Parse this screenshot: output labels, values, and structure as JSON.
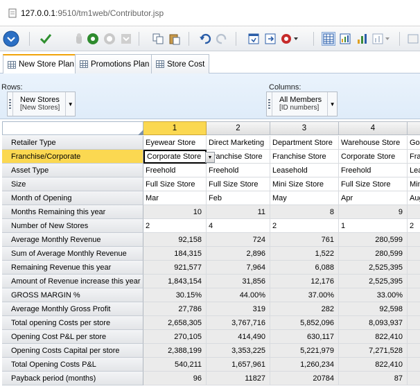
{
  "browser": {
    "url_host": "127.0.0.1",
    "url_path": ":9510/tm1web/Contributor.jsp"
  },
  "tabs": [
    {
      "label": "New Store Plan",
      "active": true
    },
    {
      "label": "Promotions Plan",
      "active": false
    },
    {
      "label": "Store Cost",
      "active": false
    }
  ],
  "dimbar": {
    "rows_label": "Rows:",
    "rows_value": "New Stores",
    "rows_sub": "[New Stores]",
    "columns_label": "Columns:",
    "columns_value": "All Members",
    "columns_sub": "[ID numbers]"
  },
  "grid": {
    "columns": [
      "1",
      "2",
      "3",
      "4",
      ""
    ],
    "selected_column": 0,
    "rows": [
      {
        "label": "Retailer Type",
        "type": "txt",
        "shade": false,
        "values": [
          "Eyewear Store",
          "Direct Marketing",
          "Department Store",
          "Warehouse Store",
          "Gol"
        ]
      },
      {
        "label": "Franchise/Corporate",
        "type": "txt",
        "shade": false,
        "selected": true,
        "values": [
          "Corporate Store",
          "Franchise Store",
          "Franchise Store",
          "Corporate Store",
          "Fra"
        ]
      },
      {
        "label": "Asset Type",
        "type": "txt",
        "shade": false,
        "values": [
          "Freehold",
          "Freehold",
          "Leasehold",
          "Freehold",
          "Lea"
        ]
      },
      {
        "label": "Size",
        "type": "txt",
        "shade": false,
        "values": [
          "Full Size Store",
          "Full Size Store",
          "Mini Size Store",
          "Full Size Store",
          "Min"
        ]
      },
      {
        "label": "Month of Opening",
        "type": "txt",
        "shade": false,
        "values": [
          "Mar",
          "Feb",
          "May",
          "Apr",
          "Aug"
        ]
      },
      {
        "label": "Months Remaining this year",
        "type": "num",
        "shade": true,
        "values": [
          "10",
          "11",
          "8",
          "9",
          ""
        ]
      },
      {
        "label": "Number of New Stores",
        "type": "txt",
        "shade": false,
        "values": [
          "2",
          "4",
          "2",
          "1",
          "2"
        ]
      },
      {
        "label": "Average Monthly Revenue",
        "type": "num",
        "shade": true,
        "values": [
          "92,158",
          "724",
          "761",
          "280,599",
          ""
        ]
      },
      {
        "label": "Sum of Average Monthly Revenue",
        "type": "num",
        "shade": true,
        "values": [
          "184,315",
          "2,896",
          "1,522",
          "280,599",
          ""
        ]
      },
      {
        "label": "Remaining Revenue this year",
        "type": "num",
        "shade": true,
        "values": [
          "921,577",
          "7,964",
          "6,088",
          "2,525,395",
          ""
        ]
      },
      {
        "label": "Amount of Revenue increase this year",
        "type": "num",
        "shade": true,
        "values": [
          "1,843,154",
          "31,856",
          "12,176",
          "2,525,395",
          ""
        ]
      },
      {
        "label": "GROSS MARGIN %",
        "type": "num",
        "shade": true,
        "values": [
          "30.15%",
          "44.00%",
          "37.00%",
          "33.00%",
          ""
        ]
      },
      {
        "label": "Average Monthly Gross Profit",
        "type": "num",
        "shade": true,
        "values": [
          "27,786",
          "319",
          "282",
          "92,598",
          ""
        ]
      },
      {
        "label": "Total opening Costs per store",
        "type": "num",
        "shade": true,
        "values": [
          "2,658,305",
          "3,767,716",
          "5,852,096",
          "8,093,937",
          ""
        ]
      },
      {
        "label": "Opening Cost P&L per store",
        "type": "num",
        "shade": true,
        "values": [
          "270,105",
          "414,490",
          "630,117",
          "822,410",
          ""
        ]
      },
      {
        "label": "Opening Costs Capital per store",
        "type": "num",
        "shade": true,
        "values": [
          "2,388,199",
          "3,353,225",
          "5,221,979",
          "7,271,528",
          ""
        ]
      },
      {
        "label": "Total Opening Costs P&L",
        "type": "num",
        "shade": true,
        "values": [
          "540,211",
          "1,657,961",
          "1,260,234",
          "822,410",
          ""
        ]
      },
      {
        "label": "Payback period (months)",
        "type": "num",
        "shade": true,
        "values": [
          "96",
          "11827",
          "20784",
          "87",
          ""
        ]
      }
    ]
  }
}
